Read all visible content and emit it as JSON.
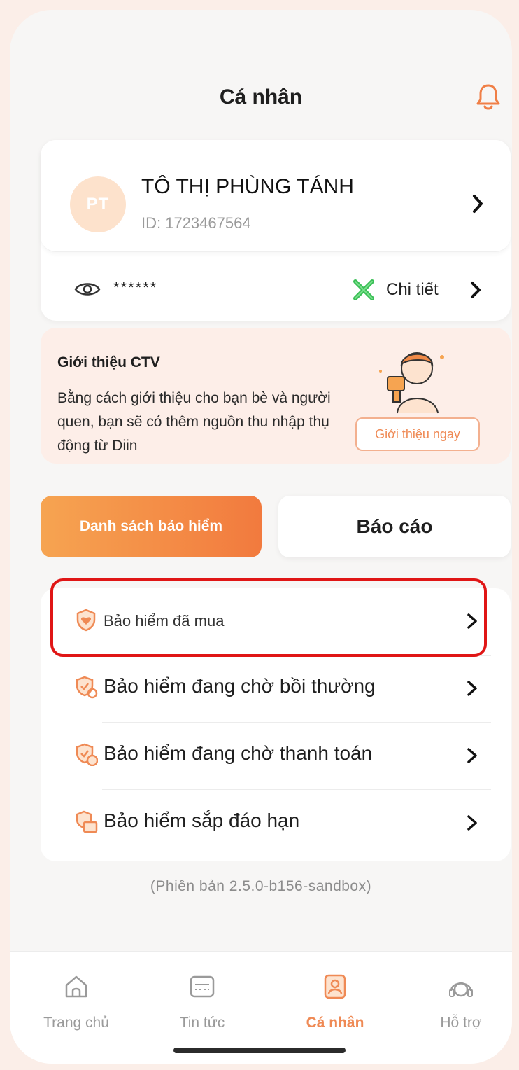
{
  "header": {
    "title": "Cá nhân",
    "bell_icon": "bell-icon"
  },
  "profile": {
    "avatar_initials": "PT",
    "name": "TÔ THỊ PHÙNG TÁNH",
    "id": "ID: 1723467564",
    "masked_value": "******",
    "detail_label": "Chi tiết"
  },
  "referral": {
    "title": "Giới thiệu CTV",
    "description": "Bằng cách giới thiệu cho bạn bè và người quen, bạn sẽ có thêm nguồn thu nhập thụ động từ Diin",
    "button_label": "Giới thiệu ngay"
  },
  "tabs": [
    {
      "label": "Danh sách bảo hiểm",
      "active": true
    },
    {
      "label": "Báo cáo",
      "active": false
    }
  ],
  "insurance_list": [
    {
      "label": "Bảo hiểm đã mua",
      "icon": "shield-heart-icon"
    },
    {
      "label": "Bảo hiểm đang chờ bồi thường",
      "icon": "shield-refresh-icon"
    },
    {
      "label": "Bảo hiểm đang chờ thanh toán",
      "icon": "shield-dollar-icon"
    },
    {
      "label": "Bảo hiểm sắp đáo hạn",
      "icon": "shield-calendar-icon"
    }
  ],
  "version": "(Phiên bản 2.5.0-b156-sandbox)",
  "bottom_nav": [
    {
      "label": "Trang chủ",
      "icon": "home-icon",
      "active": false
    },
    {
      "label": "Tin tức",
      "icon": "news-icon",
      "active": false
    },
    {
      "label": "Cá nhân",
      "icon": "profile-icon",
      "active": true
    },
    {
      "label": "Hỗ trợ",
      "icon": "support-icon",
      "active": false
    }
  ],
  "colors": {
    "accent": "#f27a3e",
    "accent_light": "#f6a451",
    "highlight": "#e01616",
    "detail_icon": "#3bbf57"
  }
}
